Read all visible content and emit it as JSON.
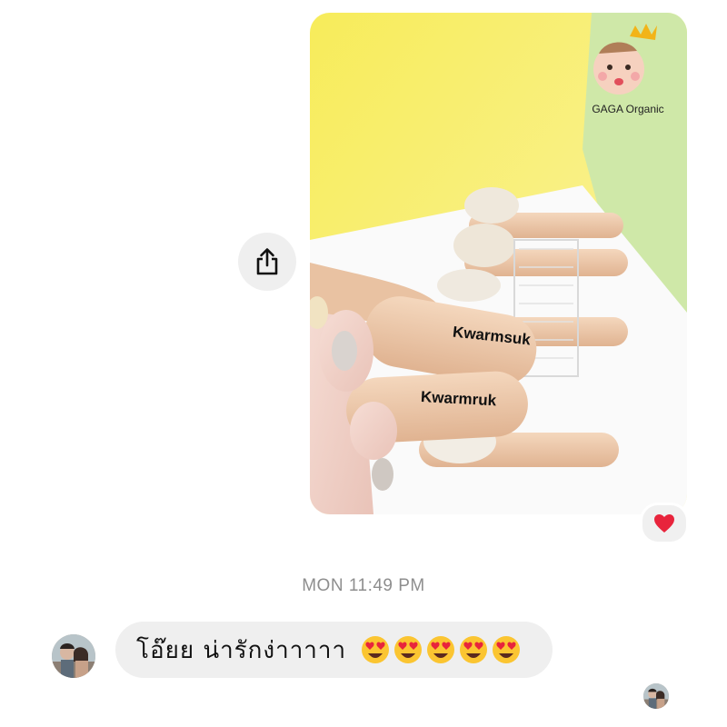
{
  "thread": {
    "image_message": {
      "watermark_brand": "GAGA Organic",
      "product_labels": [
        "Kwarmsuk",
        "Kwarmruk"
      ],
      "reaction": "heart",
      "accent_color": "#e8243c"
    },
    "timestamp": "MON 11:49 PM",
    "received_message": {
      "text": "โอ๊ยย  น่ารักง่าาาาา",
      "emoji_count": 5,
      "emoji": "heart-eyes"
    }
  },
  "icons": {
    "share": "share-icon",
    "reaction": "heart-icon",
    "emoji": "heart-eyes-emoji-icon"
  },
  "colors": {
    "bubble_bg": "#efefef",
    "timestamp": "#8e8e8e",
    "photo_wall": "#f5e84a",
    "photo_wall_right": "#c8e6a2"
  }
}
